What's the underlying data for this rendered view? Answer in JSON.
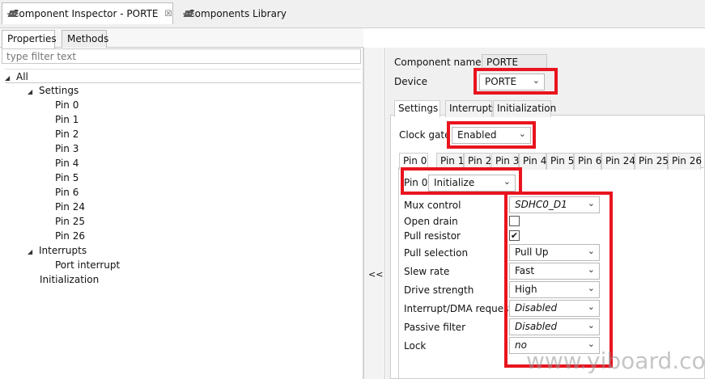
{
  "view_tabs": [
    {
      "label": "Component Inspector - PORTE",
      "close": "☒"
    },
    {
      "label": "Components Library"
    }
  ],
  "left": {
    "subtabs": [
      "Properties",
      "Methods"
    ],
    "filter_placeholder": "type filter text",
    "tree": {
      "root": "All",
      "settings": "Settings",
      "pins": [
        "Pin 0",
        "Pin 1",
        "Pin 2",
        "Pin 3",
        "Pin 4",
        "Pin 5",
        "Pin 6",
        "Pin 24",
        "Pin 25",
        "Pin 26"
      ],
      "interrupts": "Interrupts",
      "port_interrupt": "Port interrupt",
      "initialization": "Initialization"
    }
  },
  "collapse_label": "<<",
  "right": {
    "component_name_label": "Component name",
    "component_name_value": "PORTE",
    "device_label": "Device",
    "device_value": "PORTE",
    "tabs": [
      "Settings",
      "Interrupts",
      "Initialization"
    ],
    "clock_gate_label": "Clock gate",
    "clock_gate_value": "Enabled",
    "pin_tabs": [
      "Pin 0",
      "Pin 1",
      "Pin 2",
      "Pin 3",
      "Pin 4",
      "Pin 5",
      "Pin 6",
      "Pin 24",
      "Pin 25",
      "Pin 26"
    ],
    "pin_label": "Pin 0",
    "pin_mode": "Initialize",
    "props": {
      "mux_control": {
        "label": "Mux control",
        "value": "SDHC0_D1"
      },
      "open_drain": {
        "label": "Open drain"
      },
      "pull_resistor": {
        "label": "Pull resistor",
        "check": "✔"
      },
      "pull_selection": {
        "label": "Pull selection",
        "value": "Pull Up"
      },
      "slew_rate": {
        "label": "Slew rate",
        "value": "Fast"
      },
      "drive_strength": {
        "label": "Drive strength",
        "value": "High"
      },
      "interrupt_dma": {
        "label": "Interrupt/DMA request",
        "value": "Disabled"
      },
      "passive_filter": {
        "label": "Passive filter",
        "value": "Disabled"
      },
      "lock": {
        "label": "Lock",
        "value": "no"
      }
    }
  },
  "watermark": "www.yiboard.com",
  "colors": {
    "highlight": "#e8141e"
  }
}
